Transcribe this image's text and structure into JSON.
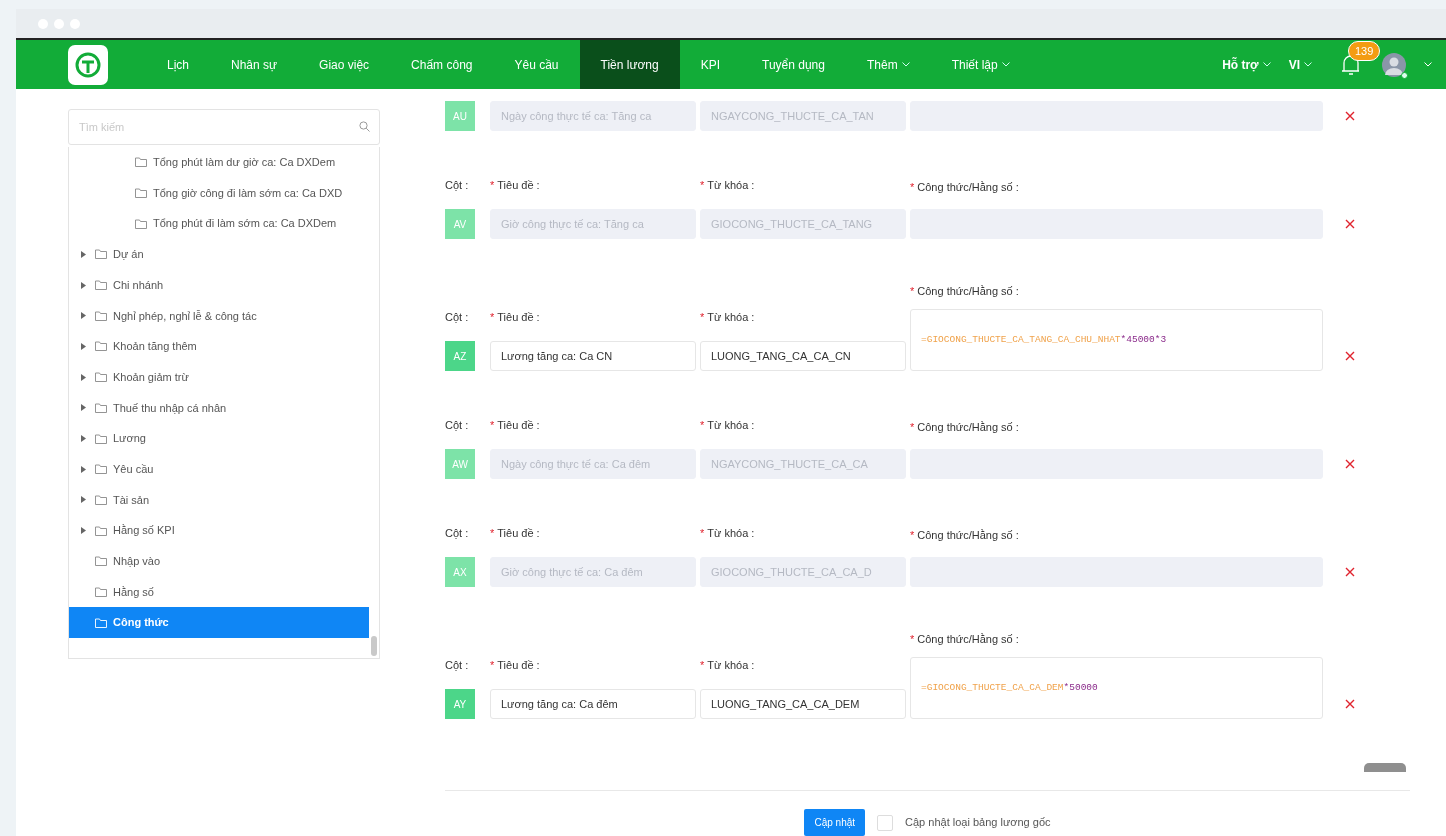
{
  "nav": {
    "items": [
      {
        "label": "Lịch",
        "selected": false,
        "dropdown": false
      },
      {
        "label": "Nhân sự",
        "selected": false,
        "dropdown": false
      },
      {
        "label": "Giao việc",
        "selected": false,
        "dropdown": false
      },
      {
        "label": "Chấm công",
        "selected": false,
        "dropdown": false
      },
      {
        "label": "Yêu cầu",
        "selected": false,
        "dropdown": false
      },
      {
        "label": "Tiền lương",
        "selected": true,
        "dropdown": false
      },
      {
        "label": "KPI",
        "selected": false,
        "dropdown": false
      },
      {
        "label": "Tuyển dụng",
        "selected": false,
        "dropdown": false
      },
      {
        "label": "Thêm",
        "selected": false,
        "dropdown": true
      },
      {
        "label": "Thiết lập",
        "selected": false,
        "dropdown": true
      }
    ],
    "right": [
      {
        "label": "Hỗ trợ",
        "dropdown": true
      },
      {
        "label": "VI",
        "dropdown": true
      }
    ],
    "notification_count": "139"
  },
  "sidebar": {
    "search": {
      "placeholder": "Tìm kiếm"
    },
    "tree": {
      "continued_children": [
        {
          "label": "Tổng phút làm dư giờ ca: Ca DXDem"
        },
        {
          "label": "Tổng giờ công đi làm sớm ca: Ca DXD"
        },
        {
          "label": "Tổng phút đi làm sớm ca: Ca DXDem"
        }
      ],
      "items": [
        {
          "label": "Dự án",
          "expandable": true,
          "selected": false
        },
        {
          "label": "Chi nhánh",
          "expandable": true,
          "selected": false
        },
        {
          "label": "Nghỉ phép, nghỉ lễ & công tác",
          "expandable": true,
          "selected": false
        },
        {
          "label": "Khoản tăng thêm",
          "expandable": true,
          "selected": false
        },
        {
          "label": "Khoản giảm trừ",
          "expandable": true,
          "selected": false
        },
        {
          "label": "Thuế thu nhập cá nhân",
          "expandable": true,
          "selected": false
        },
        {
          "label": "Lương",
          "expandable": true,
          "selected": false
        },
        {
          "label": "Yêu cầu",
          "expandable": true,
          "selected": false
        },
        {
          "label": "Tài sản",
          "expandable": true,
          "selected": false
        },
        {
          "label": "Hằng số KPI",
          "expandable": true,
          "selected": false
        },
        {
          "label": "Nhập vào",
          "expandable": false,
          "selected": false
        },
        {
          "label": "Hằng số",
          "expandable": false,
          "selected": false
        },
        {
          "label": "Công thức",
          "expandable": false,
          "selected": true
        }
      ]
    }
  },
  "rows": [
    {
      "code": "AU",
      "disabled": true,
      "title": "Ngày công thực tế ca: Tăng ca",
      "keyword": "NGAYCONG_THUCTE_CA_TAN",
      "formula": []
    },
    {
      "code": "AV",
      "disabled": true,
      "labels": {
        "column": "Cột :",
        "title": {
          "mark": "*",
          "text": "Tiêu đề :"
        },
        "keyword": {
          "mark": "*",
          "text": "Từ khóa :"
        },
        "formula": {
          "mark": "*",
          "text": "Công thức/Hằng số :"
        }
      },
      "title": "Giờ công thực tế ca: Tăng ca",
      "keyword": "GIOCONG_THUCTE_CA_TANG",
      "formula": []
    },
    {
      "code": "AZ",
      "disabled": false,
      "labels": {
        "column": "Cột :",
        "title": {
          "mark": "*",
          "text": "Tiêu đề :"
        },
        "keyword": {
          "mark": "*",
          "text": "Từ khóa :"
        },
        "formula": {
          "mark": "*",
          "text": "Công thức/Hằng số :"
        }
      },
      "title": "Lương tăng ca: Ca CN",
      "keyword": "LUONG_TANG_CA_CA_CN",
      "formula": [
        {
          "kind": "variable",
          "text": "=GIOCONG_THUCTE_CA_TANG_CA_CHU_NHAT"
        },
        {
          "kind": "number",
          "text": "*45000*3"
        }
      ]
    },
    {
      "code": "AW",
      "disabled": true,
      "labels": {
        "column": "Cột :",
        "title": {
          "mark": "*",
          "text": "Tiêu đề :"
        },
        "keyword": {
          "mark": "*",
          "text": "Từ khóa :"
        },
        "formula": {
          "mark": "*",
          "text": "Công thức/Hằng số :"
        }
      },
      "title": "Ngày công thực tế ca: Ca đêm",
      "keyword": "NGAYCONG_THUCTE_CA_CA",
      "formula": []
    },
    {
      "code": "AX",
      "disabled": true,
      "labels": {
        "column": "Cột :",
        "title": {
          "mark": "*",
          "text": "Tiêu đề :"
        },
        "keyword": {
          "mark": "*",
          "text": "Từ khóa :"
        },
        "formula": {
          "mark": "*",
          "text": "Công thức/Hằng số :"
        }
      },
      "title": "Giờ công thực tế ca: Ca đêm",
      "keyword": "GIOCONG_THUCTE_CA_CA_D",
      "formula": []
    },
    {
      "code": "AY",
      "disabled": false,
      "labels": {
        "column": "Cột :",
        "title": {
          "mark": "*",
          "text": "Tiêu đề :"
        },
        "keyword": {
          "mark": "*",
          "text": "Từ khóa :"
        },
        "formula": {
          "mark": "*",
          "text": "Công thức/Hằng số :"
        }
      },
      "title": "Lương tăng ca: Ca đêm",
      "keyword": "LUONG_TANG_CA_CA_DEM",
      "formula": [
        {
          "kind": "variable",
          "text": "=GIOCONG_THUCTE_CA_CA_DEM"
        },
        {
          "kind": "number",
          "text": "*50000"
        }
      ]
    }
  ],
  "footer": {
    "submit": "Cập nhật",
    "checkbox": {
      "label": "Cập nhật loại bảng lương gốc",
      "checked": false
    }
  }
}
